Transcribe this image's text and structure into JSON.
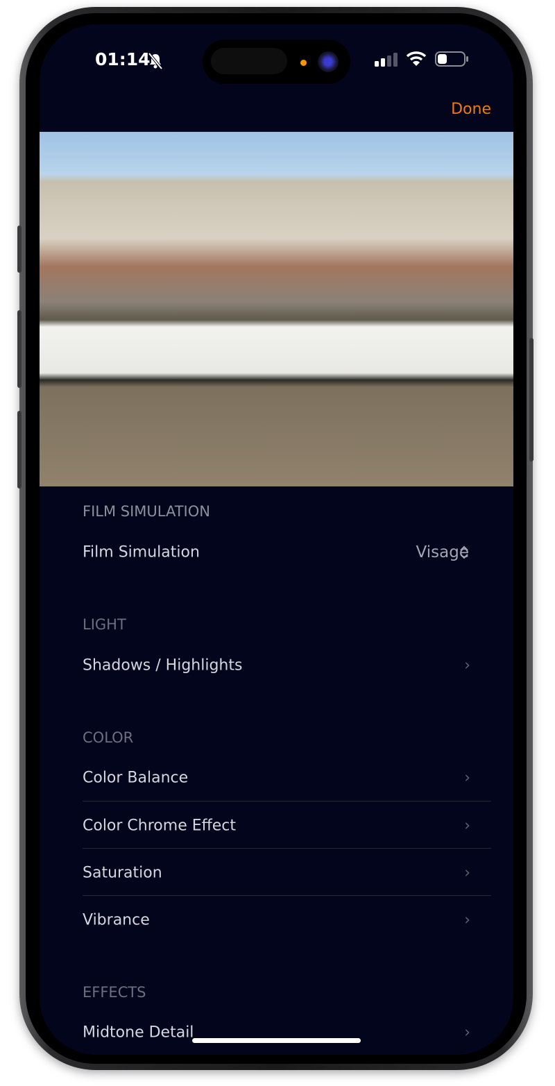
{
  "status_bar": {
    "time": "01:14",
    "icons": [
      "bell-slash-icon",
      "cellular-signal-icon",
      "wifi-icon",
      "battery-icon"
    ],
    "battery_level": 0.3
  },
  "nav": {
    "done_label": "Done",
    "accent_color": "#f07a0b"
  },
  "sections": [
    {
      "header": "FILM SIMULATION",
      "rows": [
        {
          "label": "Film Simulation",
          "value": "Visage"
        }
      ]
    },
    {
      "header": "LIGHT",
      "rows": [
        {
          "label": "Shadows / Highlights"
        }
      ]
    },
    {
      "header": "COLOR",
      "rows": [
        {
          "label": "Color Balance"
        },
        {
          "label": "Color Chrome Effect"
        },
        {
          "label": "Saturation"
        },
        {
          "label": "Vibrance"
        }
      ]
    },
    {
      "header": "EFFECTS",
      "rows": [
        {
          "label": "Midtone Detail"
        }
      ]
    }
  ],
  "chevron": "›",
  "updown": "⌃⌄"
}
